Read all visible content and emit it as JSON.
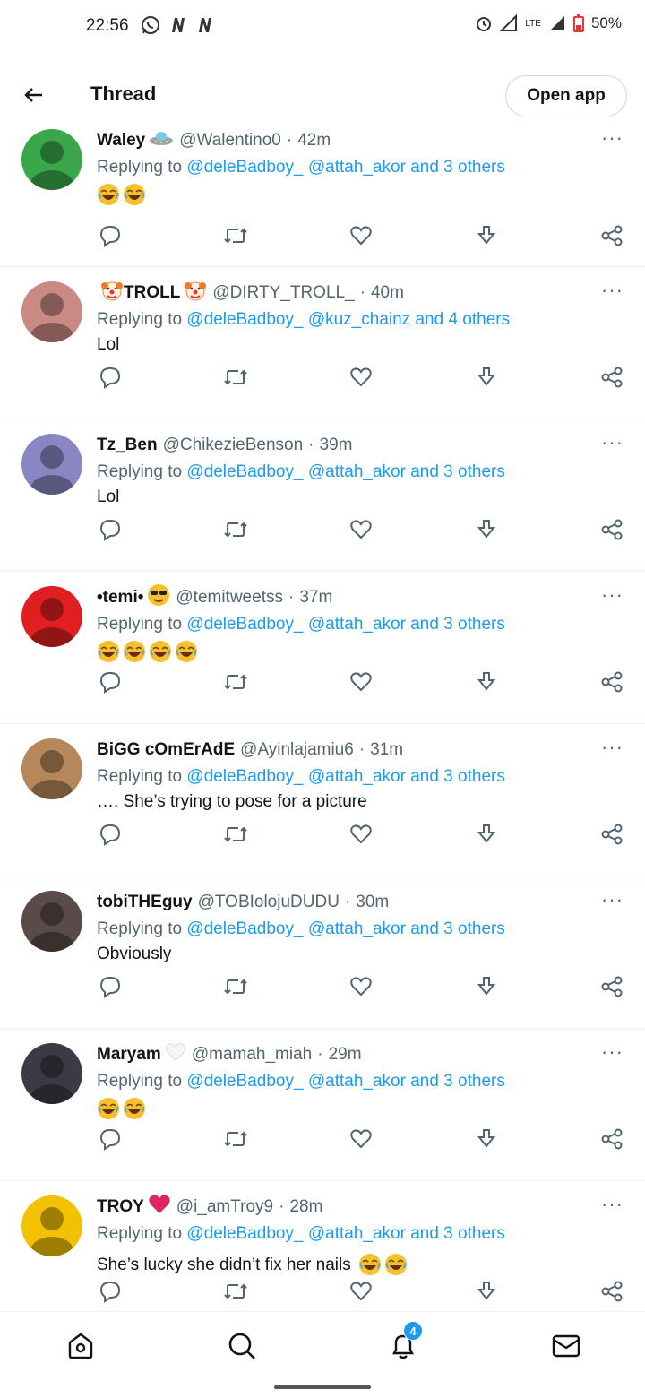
{
  "status_bar": {
    "time": "22:56",
    "battery": "50%",
    "network": "LTE",
    "icons": [
      "whatsapp-icon",
      "netflix-n-icon",
      "netflix-n-icon",
      "alarm-icon",
      "signal-icon",
      "signal-icon",
      "battery-icon"
    ]
  },
  "header": {
    "title": "Thread",
    "open_app": "Open app"
  },
  "tweets": [
    {
      "name": "Waley",
      "name_emoji": "ufo-emoji",
      "handle": "@Walentino0",
      "time": "42m",
      "replying_prefix": "Replying to",
      "mention1": "@deleBadboy_",
      "mention2": "@attah_akor",
      "others": "and 3 others",
      "text": "",
      "laugh_count": 2,
      "avatar_color": "#3aa84a"
    },
    {
      "name": "TROLL",
      "name_prefix_emoji": "clown-emoji",
      "name_emoji": "clown-emoji",
      "handle": "@DIRTY_TROLL_",
      "time": "40m",
      "replying_prefix": "Replying to",
      "mention1": "@deleBadboy_",
      "mention2": "@kuz_chainz",
      "others": "and 4 others",
      "text": "Lol",
      "laugh_count": 0,
      "avatar_color": "#c98a84"
    },
    {
      "name": "Tz_Ben",
      "handle": "@ChikezieBenson",
      "time": "39m",
      "replying_prefix": "Replying to",
      "mention1": "@deleBadboy_",
      "mention2": "@attah_akor",
      "others": "and 3 others",
      "text": "Lol",
      "laugh_count": 0,
      "avatar_color": "#8a86c4"
    },
    {
      "name": "•temi•",
      "name_emoji": "sunglasses-emoji",
      "handle": "@temitweetss",
      "time": "37m",
      "replying_prefix": "Replying to",
      "mention1": "@deleBadboy_",
      "mention2": "@attah_akor",
      "others": "and 3 others",
      "text": "",
      "laugh_count": 4,
      "avatar_color": "#e02020"
    },
    {
      "name": "BiGG cOmErAdE",
      "handle": "@Ayinlajamiu6",
      "time": "31m",
      "replying_prefix": "Replying to",
      "mention1": "@deleBadboy_",
      "mention2": "@attah_akor",
      "others": "and 3 others",
      "text": "…. She’s trying to pose for a picture",
      "laugh_count": 0,
      "avatar_color": "#b5875a"
    },
    {
      "name": "tobiTHEguy",
      "handle": "@TOBIolojuDUDU",
      "time": "30m",
      "replying_prefix": "Replying to",
      "mention1": "@deleBadboy_",
      "mention2": "@attah_akor",
      "others": "and 3 others",
      "text": "Obviously",
      "laugh_count": 0,
      "avatar_color": "#5a4a48"
    },
    {
      "name": "Maryam",
      "name_emoji": "white-heart-emoji",
      "handle": "@mamah_miah",
      "time": "29m",
      "replying_prefix": "Replying to",
      "mention1": "@deleBadboy_",
      "mention2": "@attah_akor",
      "others": "and 3 others",
      "text": "",
      "laugh_count": 2,
      "avatar_color": "#3b3b45"
    },
    {
      "name": "TROY",
      "name_emoji": "red-heart-emoji",
      "handle": "@i_amTroy9",
      "time": "28m",
      "replying_prefix": "Replying to",
      "mention1": "@deleBadboy_",
      "mention2": "@attah_akor",
      "others": "and 3 others",
      "text": "She’s lucky she didn’t fix her nails",
      "laugh_count": 2,
      "avatar_color": "#f2c200"
    }
  ],
  "bottom_nav": {
    "items": [
      "home-icon",
      "search-icon",
      "notifications-icon",
      "messages-icon"
    ],
    "notif_badge": "4"
  },
  "colors": {
    "accent": "#1d9bf0",
    "secondary_text": "#536471",
    "primary_text": "#0f1419"
  }
}
